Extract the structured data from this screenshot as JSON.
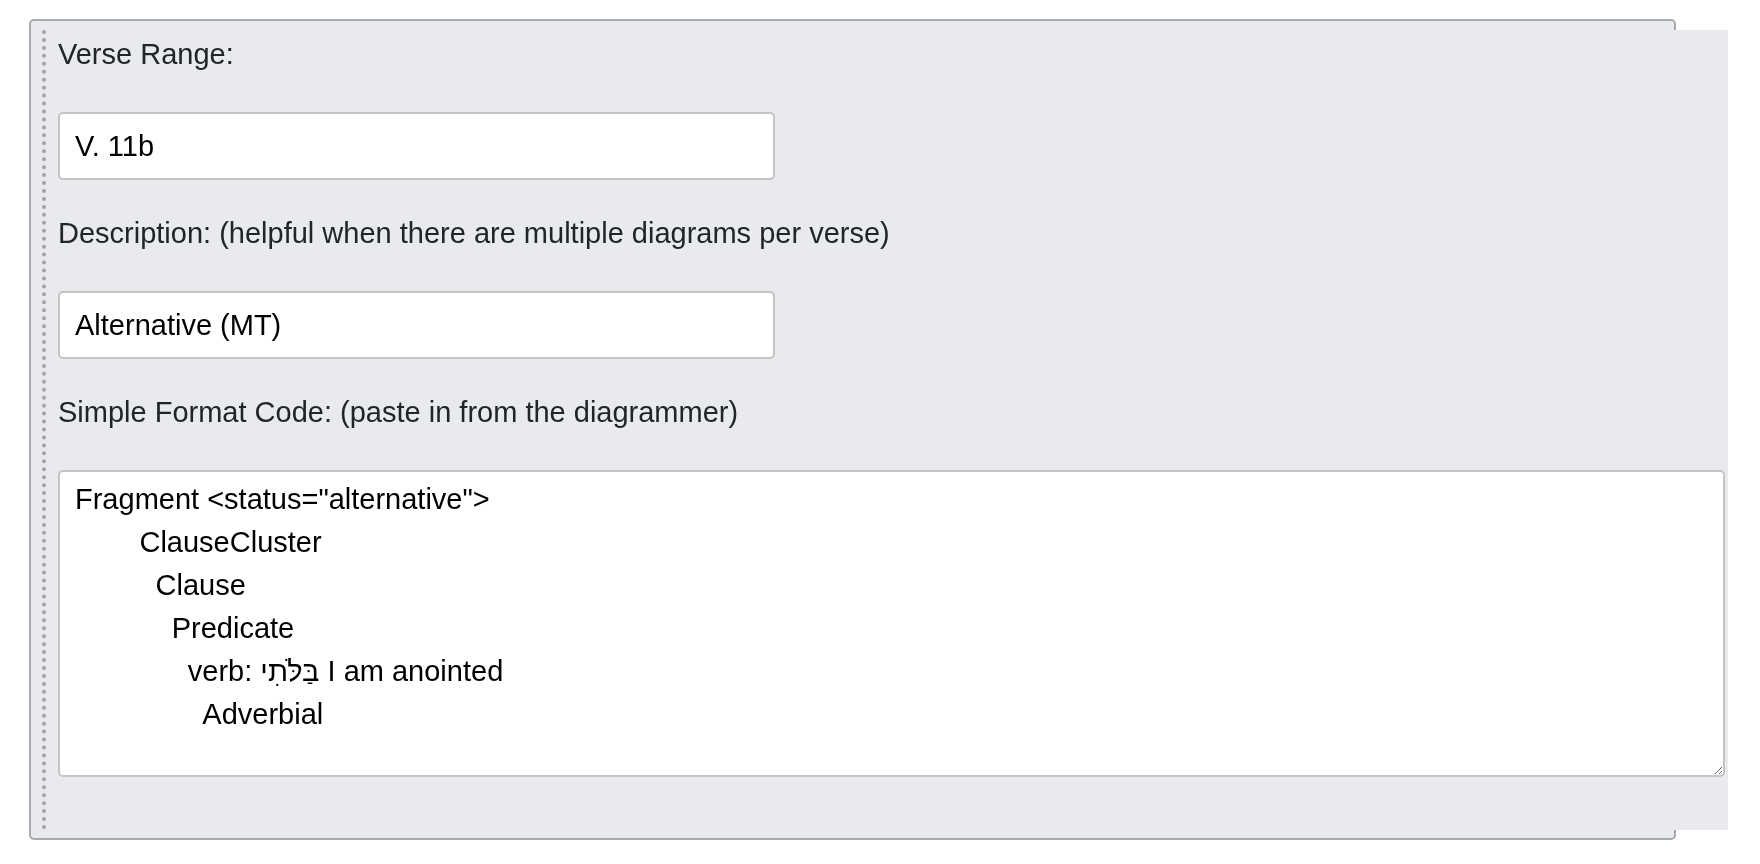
{
  "fields": [
    {
      "kind": "input",
      "label": "Verse Range:",
      "value": "V. 11b"
    },
    {
      "kind": "input",
      "label": "Description: (helpful when there are multiple diagrams per verse)",
      "value": "Alternative (MT)"
    },
    {
      "kind": "textarea",
      "label": "Simple Format Code: (paste in from the diagrammer)",
      "value": "Fragment <status=\"alternative\">\n\tClauseCluster\n\t  Clause\n\t    Predicate\n\t      verb: בַּלֹּתִי I am anointed\n\t        Adverbial"
    }
  ]
}
